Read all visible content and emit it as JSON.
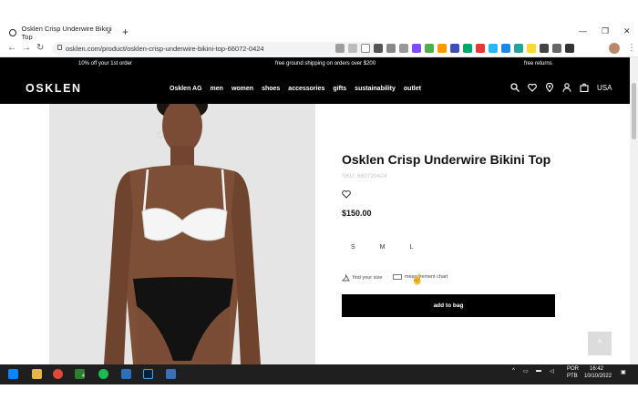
{
  "browser": {
    "tab_title": "Osklen Crisp Underwire Bikini Top",
    "new_tab_symbol": "+",
    "close_symbol": "×",
    "url": "osklen.com/product/osklen-crisp-underwire-bikini-top-66072-0424",
    "window_controls": [
      "—",
      "❐",
      "✕"
    ]
  },
  "promo": {
    "left": "10% off your 1st order",
    "center": "free ground shipping on orders over $200",
    "right": "free returns"
  },
  "header": {
    "logo": "OSKLEN",
    "menu": [
      "Osklen AG",
      "men",
      "women",
      "shoes",
      "accessories",
      "gifts",
      "sustainability",
      "outlet"
    ],
    "region": "USA",
    "icons": [
      "search-icon",
      "heart-icon",
      "location-icon",
      "user-icon",
      "bag-icon"
    ]
  },
  "product": {
    "title": "Osklen Crisp Underwire Bikini Top",
    "sku": "SKU: 660720424",
    "price": "$150.00",
    "sizes": [
      "S",
      "M",
      "L"
    ],
    "find_size": "find your size",
    "measurement_chart": "measurement chart",
    "add_to_bag": "add to bag",
    "back_to_top": "^"
  },
  "taskbar": {
    "lang_top": "POR",
    "lang_bottom": "PTB",
    "time": "16:42",
    "date": "10/10/2022",
    "badge": "4"
  },
  "colors": {
    "brand_black": "#000000",
    "sku_gray": "#c5c5c5",
    "photo_bg": "#e5e5e5"
  }
}
